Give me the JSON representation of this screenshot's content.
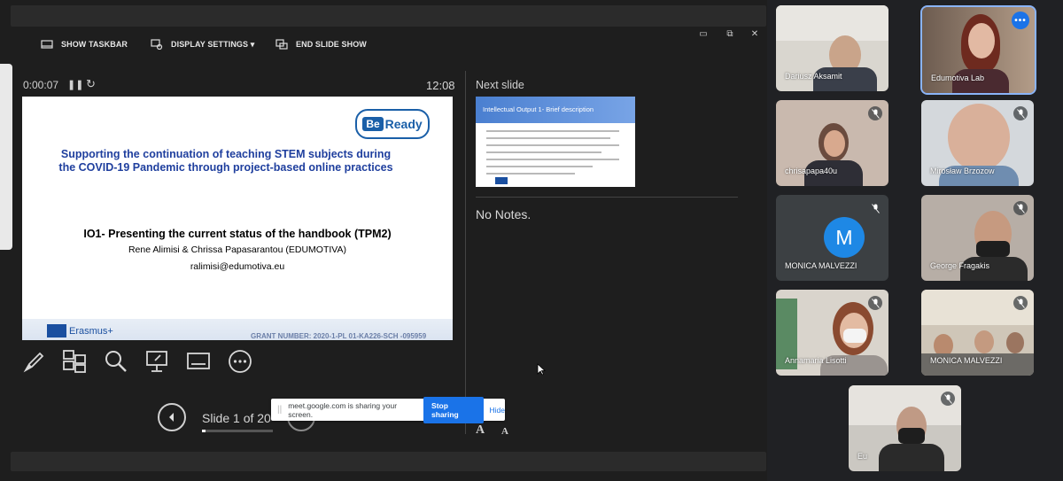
{
  "toolbar": {
    "show_taskbar": "SHOW TASKBAR",
    "display_settings": "DISPLAY SETTINGS ▾",
    "end_slide_show": "END SLIDE SHOW"
  },
  "window_controls": {
    "minimize": "▭",
    "restore": "⧉",
    "close": "✕"
  },
  "presenter": {
    "elapsed": "0:00:07",
    "clock": "12:08",
    "pause_glyph": "❚❚",
    "restart_glyph": "↻",
    "next_slide_label": "Next slide",
    "notes": "No Notes.",
    "slide_counter": "Slide 1 of 20",
    "progress_fraction": 0.05,
    "font_increase": "A",
    "font_decrease": "A"
  },
  "current_slide": {
    "logo_be": "Be",
    "logo_ready": "Ready",
    "title": "Supporting the continuation of teaching STEM subjects during the COVID-19 Pandemic through project-based online practices",
    "heading": "IO1- Presenting the current status of the handbook (TPM2)",
    "authors": "Rene Alimisi & Chrissa Papasarantou (EDUMOTIVA)",
    "email": "ralimisi@edumotiva.eu",
    "footer_program": "Erasmus+",
    "grant_number": "GRANT NUMBER: 2020-1-PL 01-KA226-SCH -095959"
  },
  "next_slide": {
    "header": "Intellectual Output 1- Brief description"
  },
  "tools": [
    "pen-tool",
    "slide-grid",
    "zoom",
    "pointer-screen",
    "subtitles",
    "more-options"
  ],
  "sharing_bar": {
    "grip": "||",
    "message": "meet.google.com is sharing your screen.",
    "stop_label": "Stop sharing",
    "hide_label": "Hide"
  },
  "participants": [
    {
      "name": "Dariusz Aksamit",
      "muted": false,
      "active": false
    },
    {
      "name": "Edumotiva Lab",
      "muted": false,
      "active": true
    },
    {
      "name": "chrisapapa40u",
      "muted": true,
      "active": false
    },
    {
      "name": "Mirosław Brzozow",
      "muted": true,
      "active": false
    },
    {
      "name": "MONICA MALVEZZI",
      "initial": "M",
      "muted": true,
      "active": false
    },
    {
      "name": "George Fragakis",
      "muted": true,
      "active": false
    },
    {
      "name": "Annamaria Lisotti",
      "muted": true,
      "active": false
    },
    {
      "name": "MONICA MALVEZZI",
      "muted": true,
      "active": false
    },
    {
      "name": "Eu",
      "muted": true,
      "active": false
    }
  ],
  "colors": {
    "accent_blue": "#1a73e8",
    "slide_title_blue": "#1f3f9e",
    "meet_background": "#202124",
    "avatar_blue": "#1e88e5"
  }
}
